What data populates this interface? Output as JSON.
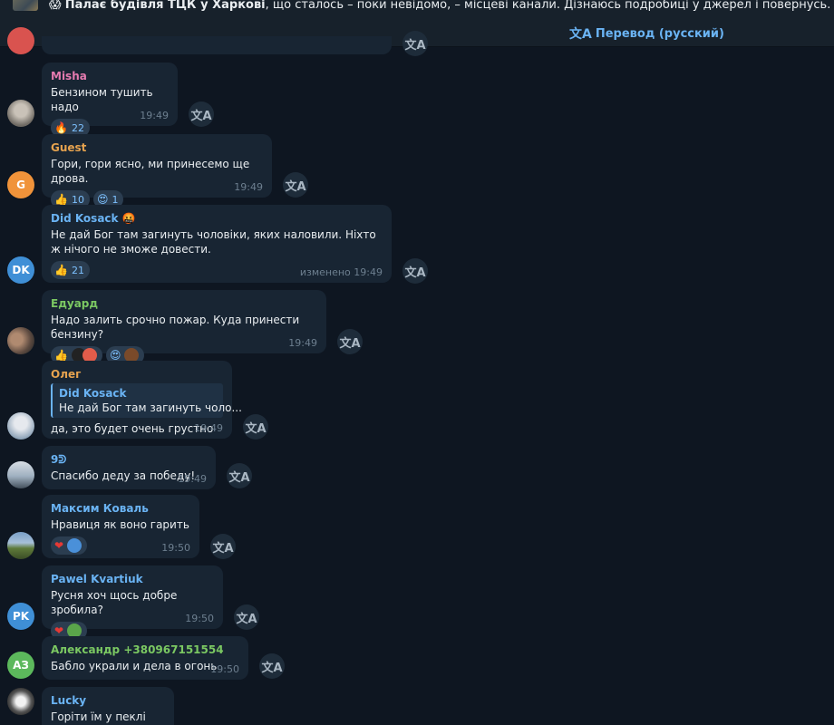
{
  "pinned": {
    "emoji": "😱",
    "headline": "Палає будівля ТЦК у Харкові",
    "rest": ", що сталось – поки невідомо, – місцеві канали.  Дізнаюсь подробиці у джерел і повернусь.  ТРУХА⚡Україна | Надіслати"
  },
  "translate_link": {
    "icon": "文A",
    "label": "Перевод (русский)"
  },
  "translate_icon": "文A",
  "messages": [
    {
      "name": "Misha",
      "text": "Бензином тушить надо",
      "time": "19:49",
      "reactions": [
        {
          "emoji": "🔥",
          "count": "22"
        }
      ]
    },
    {
      "name": "Guest",
      "avatar": "G",
      "text": "Гори, гори ясно, ми принесемо ще дрова.",
      "time": "19:49",
      "reactions": [
        {
          "emoji": "👍",
          "count": "10"
        },
        {
          "emoji": "😍",
          "count": "1"
        }
      ]
    },
    {
      "name": "Did Kosack 🤬",
      "avatar": "DK",
      "text": "Не дай Бог там загинуть чоловіки, яких наловили. Ніхто ж нічого не зможе довести.",
      "time": "изменено 19:49",
      "reactions": [
        {
          "emoji": "👍",
          "count": "21"
        }
      ]
    },
    {
      "name": "Едуард",
      "text": "Надо залить срочно пожар. Куда принести бензину?",
      "time": "19:49",
      "reactions": [
        {
          "emoji": "👍",
          "count": ""
        },
        {
          "emoji": "😍",
          "count": ""
        }
      ]
    },
    {
      "name": "Олег",
      "text": "да, это будет очень грустно",
      "time": "19:49",
      "quote": {
        "name": "Did Kosack",
        "text": "Не дай Бог там загинуть чоло..."
      }
    },
    {
      "name": "9ᕲ",
      "text": "Спасибо деду за победу!",
      "time": "19:49"
    },
    {
      "name": "Максим Коваль",
      "text": "Нравиця як воно гарить",
      "time": "19:50",
      "reactions": [
        {
          "emoji": "❤",
          "count": ""
        }
      ]
    },
    {
      "name": "Pawel Kvartiuk",
      "avatar": "PK",
      "text": "Русня хоч щось добре зробила?",
      "time": "19:50",
      "reactions": [
        {
          "emoji": "❤",
          "count": ""
        }
      ]
    },
    {
      "name": "Александр +380967151554",
      "avatar": "АЗ",
      "text": "Бабло украли и дела в огонь",
      "time": "19:50"
    },
    {
      "name": "Lucky",
      "text": "Горіти їм у пеклі вічно",
      "time": ""
    }
  ]
}
